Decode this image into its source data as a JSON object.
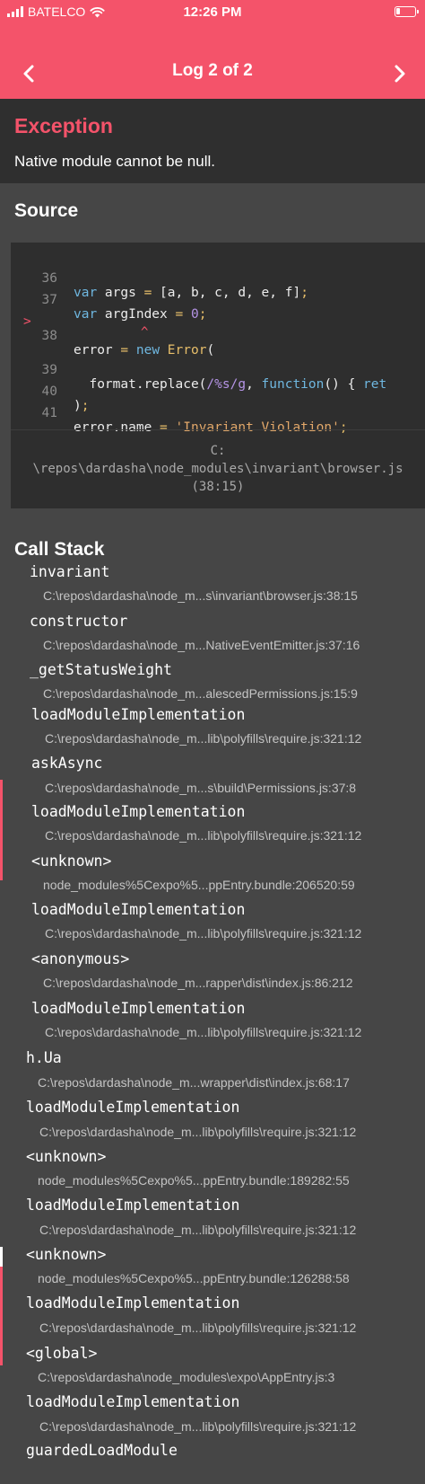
{
  "status_bar": {
    "carrier": "BATELCO",
    "time": "12:26 PM"
  },
  "nav": {
    "title": "Log 2 of 2"
  },
  "exception": {
    "title": "Exception",
    "message": "Native module cannot be null."
  },
  "source": {
    "heading": "Source",
    "lines": [
      {
        "num": "36",
        "highlighted": false
      },
      {
        "num": "37",
        "highlighted": false
      },
      {
        "num": "38",
        "highlighted": true,
        "marker": ">"
      },
      {
        "num": "39",
        "highlighted": false
      },
      {
        "num": "40",
        "highlighted": false
      },
      {
        "num": "41",
        "highlighted": false
      }
    ],
    "caret": "^",
    "file_path_line1": "C:",
    "file_path_line2": "\\repos\\dardasha\\node_modules\\invariant\\browser.js",
    "file_path_line3": "(38:15)"
  },
  "call_stack": {
    "heading": "Call Stack",
    "frames": [
      {
        "name": "invariant",
        "path": "C:\\repos\\dardasha\\node_m...s\\invariant\\browser.js:38:15"
      },
      {
        "name": "constructor",
        "path": "C:\\repos\\dardasha\\node_m...NativeEventEmitter.js:37:16"
      },
      {
        "name": "_getStatusWeight",
        "path": "C:\\repos\\dardasha\\node_m...alescedPermissions.js:15:9"
      },
      {
        "name": "loadModuleImplementation",
        "path": "C:\\repos\\dardasha\\node_m...lib\\polyfills\\require.js:321:12"
      },
      {
        "name": "askAsync",
        "path": "C:\\repos\\dardasha\\node_m...s\\build\\Permissions.js:37:8"
      },
      {
        "name": "loadModuleImplementation",
        "path": "C:\\repos\\dardasha\\node_m...lib\\polyfills\\require.js:321:12"
      },
      {
        "name": "<unknown>",
        "path": "node_modules%5Cexpo%5...ppEntry.bundle:206520:59"
      },
      {
        "name": "loadModuleImplementation",
        "path": "C:\\repos\\dardasha\\node_m...lib\\polyfills\\require.js:321:12"
      },
      {
        "name": "<anonymous>",
        "path": "C:\\repos\\dardasha\\node_m...rapper\\dist\\index.js:86:212"
      },
      {
        "name": "loadModuleImplementation",
        "path": "C:\\repos\\dardasha\\node_m...lib\\polyfills\\require.js:321:12"
      },
      {
        "name": "h.Ua",
        "path": "C:\\repos\\dardasha\\node_m...wrapper\\dist\\index.js:68:17"
      },
      {
        "name": "loadModuleImplementation",
        "path": "C:\\repos\\dardasha\\node_m...lib\\polyfills\\require.js:321:12"
      },
      {
        "name": "<unknown>",
        "path": "node_modules%5Cexpo%5...ppEntry.bundle:189282:55"
      },
      {
        "name": "loadModuleImplementation",
        "path": "C:\\repos\\dardasha\\node_m...lib\\polyfills\\require.js:321:12"
      },
      {
        "name": "<unknown>",
        "path": "node_modules%5Cexpo%5...ppEntry.bundle:126288:58"
      },
      {
        "name": "loadModuleImplementation",
        "path": "C:\\repos\\dardasha\\node_m...lib\\polyfills\\require.js:321:12"
      },
      {
        "name": "<global>",
        "path": "C:\\repos\\dardasha\\node_modules\\expo\\AppEntry.js:3"
      },
      {
        "name": "loadModuleImplementation",
        "path": "C:\\repos\\dardasha\\node_m...lib\\polyfills\\require.js:321:12"
      },
      {
        "name": "guardedLoadModule",
        "path": ""
      }
    ]
  },
  "colors": {
    "accent": "#f4536a",
    "background": "#464646",
    "exception_bg": "#2f2f2f",
    "code_bg": "#2e2e2e"
  }
}
